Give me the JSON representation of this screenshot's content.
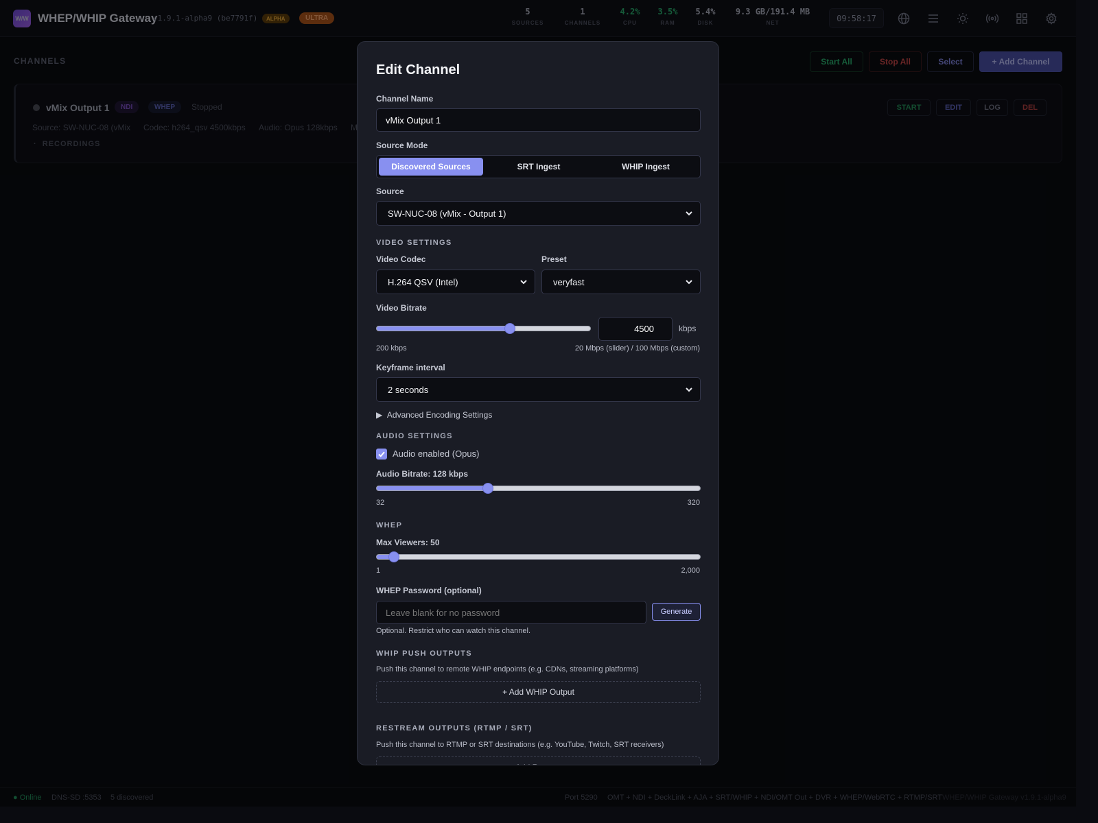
{
  "header": {
    "logo_text": "W/W",
    "title": "WHEP/WHIP Gateway",
    "version": "v1.9.1-alpha9 (be7791f)",
    "badge_alpha": "ALPHA",
    "badge_ultra": "ULTRA",
    "stats": [
      {
        "value": "5",
        "label": "SOURCES"
      },
      {
        "value": "1",
        "label": "CHANNELS"
      },
      {
        "value": "4.2%",
        "label": "CPU"
      },
      {
        "value": "3.5%",
        "label": "RAM"
      },
      {
        "value": "5.4%",
        "label": "DISK"
      },
      {
        "value": "9.3 GB/191.4 MB",
        "label": "NET"
      }
    ],
    "clock": "09:58:17",
    "icons": [
      "globe-icon",
      "menu-icon",
      "sun-icon",
      "broadcast-icon",
      "grid-icon",
      "gear-icon"
    ]
  },
  "page": {
    "section_title": "CHANNELS",
    "toolbar": {
      "start_all": "Start All",
      "stop_all": "Stop All",
      "select": "Select",
      "add_channel": "+ Add Channel"
    },
    "channel": {
      "name": "vMix Output 1",
      "tag_ndi": "NDI",
      "tag_whep": "WHEP",
      "status": "Stopped",
      "source": "Source: SW-NUC-08 (vMix",
      "codec": "Codec: h264_qsv 4500kbps",
      "audio": "Audio: Opus 128kbps",
      "more": "M",
      "recordings": "RECORDINGS",
      "actions": {
        "start": "START",
        "edit": "EDIT",
        "log": "LOG",
        "del": "DEL"
      }
    }
  },
  "modal": {
    "title": "Edit Channel",
    "channel_name_label": "Channel Name",
    "channel_name_value": "vMix Output 1",
    "source_mode_label": "Source Mode",
    "source_modes": [
      "Discovered Sources",
      "SRT Ingest",
      "WHIP Ingest"
    ],
    "source_label": "Source",
    "source_value": "SW-NUC-08 (vMix - Output 1)",
    "video_section": "VIDEO SETTINGS",
    "video_codec_label": "Video Codec",
    "video_codec_value": "H.264 QSV (Intel)",
    "preset_label": "Preset",
    "preset_value": "veryfast",
    "video_bitrate_label": "Video Bitrate",
    "video_bitrate_value": "4500",
    "video_bitrate_unit": "kbps",
    "video_bitrate_fraction": 0.63,
    "video_bitrate_min_label": "200 kbps",
    "video_bitrate_max_label": "20 Mbps (slider) / 100 Mbps (custom)",
    "keyframe_label": "Keyframe interval",
    "keyframe_value": "2 seconds",
    "advanced_label": "Advanced Encoding Settings",
    "audio_section": "AUDIO SETTINGS",
    "audio_enabled_label": "Audio enabled (Opus)",
    "audio_bitrate_label": "Audio Bitrate: 128 kbps",
    "audio_bitrate_fraction": 0.34,
    "audio_min": "32",
    "audio_max": "320",
    "whep_section": "WHEP",
    "max_viewers_label": "Max Viewers: 50",
    "max_viewers_fraction": 0.04,
    "viewers_min": "1",
    "viewers_max": "2,000",
    "whep_password_label": "WHEP Password (optional)",
    "whep_password_placeholder": "Leave blank for no password",
    "generate_label": "Generate",
    "whep_password_help": "Optional. Restrict who can watch this channel.",
    "whip_section": "WHIP PUSH OUTPUTS",
    "whip_help": "Push this channel to remote WHIP endpoints (e.g. CDNs, streaming platforms)",
    "add_whip_label": "+ Add WHIP Output",
    "restream_section": "RESTREAM OUTPUTS (RTMP / SRT)",
    "restream_help": "Push this channel to RTMP or SRT destinations (e.g. YouTube, Twitch, SRT receivers)",
    "add_restream_label": "+ Add Restream"
  },
  "footer": {
    "online": "● Online",
    "dns": "DNS-SD :5353",
    "discovered": "5 discovered",
    "port": "Port 5290",
    "features": "OMT + NDI + DeckLink + AJA + SRT/WHIP + NDI/OMT Out + DVR + WHEP/WebRTC + RTMP/SRT",
    "brand": "WHEP/WHIP Gateway v1.9.1-alpha9"
  },
  "colors": {
    "accent": "#8890f0",
    "green": "#28a86a",
    "red": "#d14a4a",
    "purple": "#8b5cf6"
  }
}
